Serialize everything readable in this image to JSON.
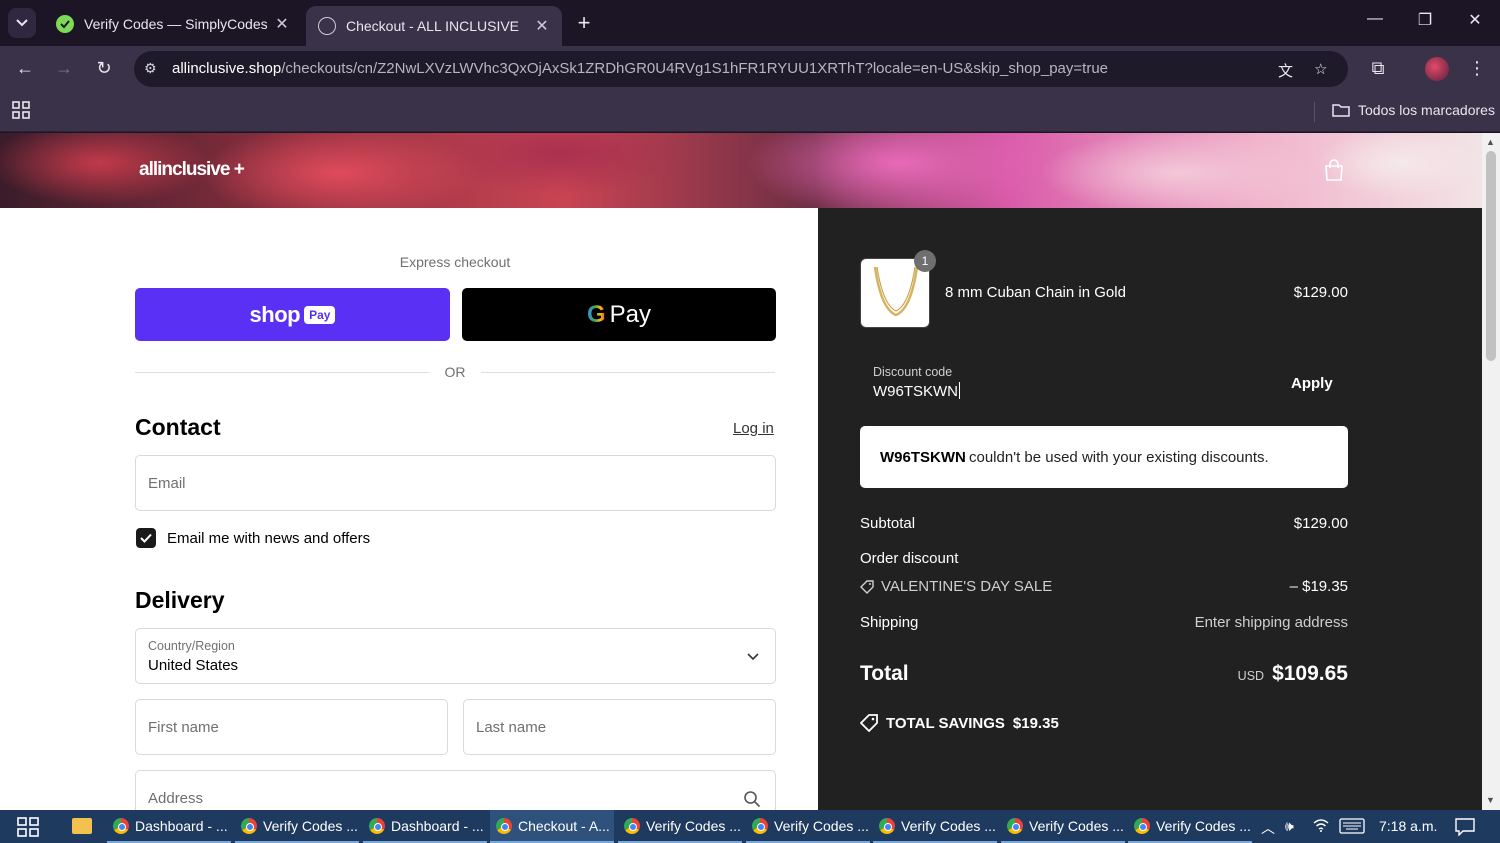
{
  "browser": {
    "tabs": [
      {
        "title": "Verify Codes — SimplyCodes",
        "active": false
      },
      {
        "title": "Checkout - ALL INCLUSIVE",
        "active": true
      }
    ],
    "url_host": "allinclusive.shop",
    "url_path": "/checkouts/cn/Z2NwLXVzLWVhc3QxOjAxSk1ZRDhGR0U4RVg1S1hFR1RYUU1XRThT?locale=en-US&skip_shop_pay=true",
    "bookmarks_label": "Todos los marcadores"
  },
  "store": {
    "brand": "allinclusive +"
  },
  "checkout": {
    "express_label": "Express checkout",
    "shop_pay": {
      "shop": "shop",
      "pay": "Pay"
    },
    "gpay": {
      "g": "G",
      "pay": "Pay"
    },
    "or_text": "OR",
    "contact_heading": "Contact",
    "login_link": "Log in",
    "email_placeholder": "Email",
    "news_checkbox_label": "Email me with news and offers",
    "news_checked": true,
    "delivery_heading": "Delivery",
    "country_label": "Country/Region",
    "country_value": "United States",
    "first_name_placeholder": "First name",
    "last_name_placeholder": "Last name",
    "address_placeholder": "Address"
  },
  "summary": {
    "item": {
      "quantity": "1",
      "name": "8 mm Cuban Chain in Gold",
      "price": "$129.00"
    },
    "discount_label": "Discount code",
    "discount_value": "W96TSKWN",
    "apply_label": "Apply",
    "error": {
      "code": "W96TSKWN",
      "message": "couldn't be used with your existing discounts."
    },
    "subtotal_label": "Subtotal",
    "subtotal_value": "$129.00",
    "order_discount_label": "Order discount",
    "sale_name": "VALENTINE'S DAY SALE",
    "sale_value": "– $19.35",
    "shipping_label": "Shipping",
    "shipping_value": "Enter shipping address",
    "total_label": "Total",
    "total_currency": "USD",
    "total_value": "$109.65",
    "savings_label": "TOTAL SAVINGS",
    "savings_value": "$19.35"
  },
  "taskbar": {
    "items": [
      {
        "label": "Dashboard - ..."
      },
      {
        "label": "Verify Codes ..."
      },
      {
        "label": "Dashboard - ..."
      },
      {
        "label": "Checkout - A...",
        "active": true
      },
      {
        "label": "Verify Codes ..."
      },
      {
        "label": "Verify Codes ..."
      },
      {
        "label": "Verify Codes ..."
      },
      {
        "label": "Verify Codes ..."
      },
      {
        "label": "Verify Codes ..."
      }
    ],
    "time": "7:18 a.m."
  },
  "colors": {
    "shop_pay": "#5a31f4",
    "summary_bg": "#212121",
    "browser_frame": "#1b1525",
    "taskbar": "#1f3a5f"
  }
}
